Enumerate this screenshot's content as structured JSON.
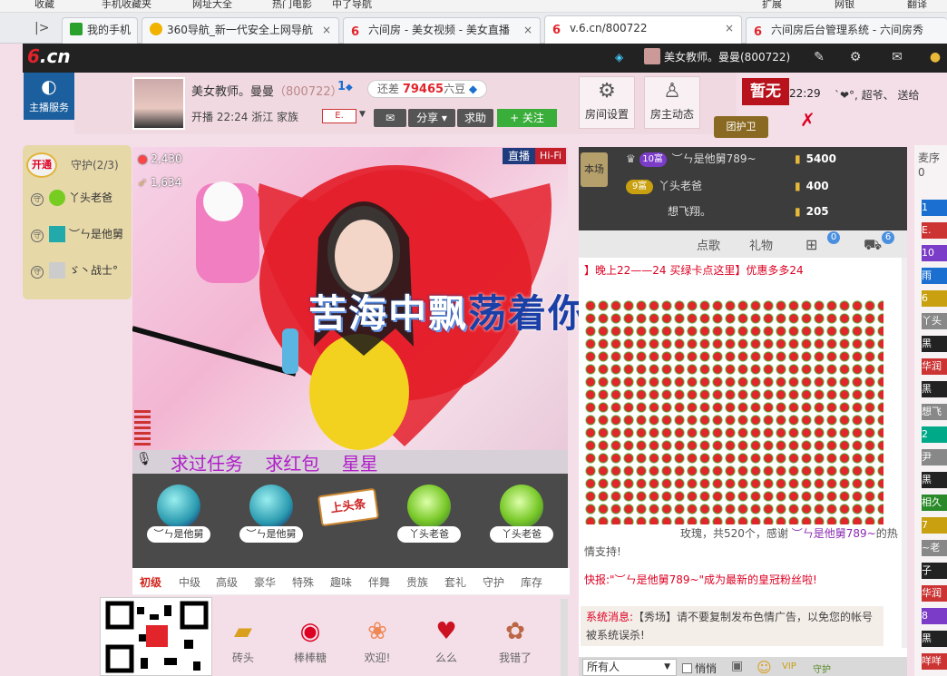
{
  "bookmarks": [
    "收藏",
    "手机收藏夹",
    "网址大全",
    "热门电影",
    "中了导航",
    "扩展",
    "网银",
    "翻译"
  ],
  "tabs": [
    {
      "label": "我的手机",
      "icon": "phone-icon",
      "color": "#2aa12a"
    },
    {
      "label": "360导航_新一代安全上网导航",
      "icon": "plus-icon",
      "color": "#f2b200"
    },
    {
      "label": "六间房 - 美女视频 - 美女直播",
      "icon": "six-icon",
      "color": "#e2242b"
    },
    {
      "label": "v.6.cn/800722",
      "icon": "six-icon",
      "color": "#e2242b",
      "active": true
    },
    {
      "label": "六间房后台管理系统 - 六间房秀",
      "icon": "six-icon",
      "color": "#e2242b"
    }
  ],
  "header": {
    "logo_a": "6",
    "logo_b": ".cn",
    "user": "美女教师。曼曼(800722)"
  },
  "qq": {
    "label": "主播服务"
  },
  "anchor": {
    "name": "美女教师。曼曼",
    "room_id": "（800722）",
    "level": "1",
    "diff_label": "还差",
    "diff_value": "79465",
    "diff_unit": "六豆",
    "meta": "开播 22:24  浙江  家族",
    "family": "E.",
    "share": "分享",
    "help": "求助",
    "follow": "+ 关注"
  },
  "room_buttons": [
    {
      "label": "房间设置",
      "icon": "gear-icon"
    },
    {
      "label": "房主动态",
      "icon": "person-icon"
    }
  ],
  "zanwu": "暂无",
  "guard_team": "团护卫",
  "clock": "22:29",
  "ticker": "`❤°, 超爷、 送给",
  "guard": {
    "open": "开通",
    "title": "守护(2/3)",
    "members": [
      {
        "name": "丫头老爸",
        "thumb": "#7c2"
      },
      {
        "name": "︶ㄣ是他舅",
        "thumb": "#2aa"
      },
      {
        "name": "ゞ丶战士°",
        "thumb": "#ccc"
      }
    ]
  },
  "video": {
    "wealth": "2,430",
    "fans": "1,634",
    "live": "直播",
    "hifi": "Hi-Fi",
    "song_a": "苦海中飘",
    "song_b": "荡着你"
  },
  "task": {
    "text": "求过任务 求红包 星星"
  },
  "seats": [
    {
      "name": "︶ㄣ是他舅",
      "color": "#2a9ab0"
    },
    {
      "name": "︶ㄣ是他舅",
      "color": "#2a9ab0"
    },
    {
      "name": "丫头老爸",
      "color": "#78c828"
    },
    {
      "name": "丫头老爸",
      "color": "#78c828"
    }
  ],
  "headline": "上头条",
  "gift_tabs": [
    "初级",
    "中级",
    "高级",
    "豪华",
    "特殊",
    "趣味",
    "伴舞",
    "贵族",
    "套礼",
    "守护",
    "库存"
  ],
  "gifts": [
    {
      "name": "砖头",
      "icon": "brick-icon"
    },
    {
      "name": "棒棒糖",
      "icon": "lollipop-icon"
    },
    {
      "name": "欢迎!",
      "icon": "welcome-icon"
    },
    {
      "name": "么么",
      "icon": "kiss-icon"
    },
    {
      "name": "我错了",
      "icon": "sorry-icon"
    }
  ],
  "fans": {
    "title": "本场",
    "rows": [
      {
        "rank": "10富",
        "name": "︶ㄣ是他舅789~",
        "score": "5400"
      },
      {
        "rank": "9富",
        "name": "丫头老爸",
        "score": "400"
      },
      {
        "rank": "",
        "name": "想飞翔。",
        "score": "205"
      }
    ]
  },
  "chat_tabs": [
    {
      "label": "点歌"
    },
    {
      "label": "礼物"
    },
    {
      "label": "",
      "icon": "gamepad-icon",
      "badge": "0"
    },
    {
      "label": "",
      "icon": "car-icon",
      "badge": "6"
    }
  ],
  "chat": {
    "promo": "】晚上22——24 买绿卡点这里】优惠多多24",
    "rose_pre": "玫瑰，共520个，感谢",
    "rose_user": "︶ㄣ是他舅789~",
    "rose_post": "的热情支持!",
    "flash": "快报:\"︶ㄣ是他舅789~\"成为最新的皇冠粉丝啦!",
    "sys_label": "系统消息:",
    "sys_text": "【秀场】请不要复制发布色情广告，以免您的帐号被系统误杀!"
  },
  "input": {
    "target": "所有人",
    "whisper": "悄悄"
  },
  "users": {
    "title": "麦序",
    "count": "0",
    "rows": [
      {
        "label": "1",
        "color": "#1a6fd0"
      },
      {
        "label": "E.",
        "color": "#c33"
      },
      {
        "label": "10",
        "color": "#7b3cc8"
      },
      {
        "label": "雨",
        "color": "#1a6fd0"
      },
      {
        "label": "6",
        "color": "#c8a010"
      },
      {
        "label": "丫头",
        "color": "#888"
      },
      {
        "label": "黑",
        "color": "#222"
      },
      {
        "label": "华润",
        "color": "#c33"
      },
      {
        "label": "黑",
        "color": "#222"
      },
      {
        "label": "想飞",
        "color": "#888"
      },
      {
        "label": "2",
        "color": "#0a8"
      },
      {
        "label": "尹",
        "color": "#888"
      },
      {
        "label": "黑",
        "color": "#222"
      },
      {
        "label": "相久",
        "color": "#2a8a2a"
      },
      {
        "label": "7",
        "color": "#c8a010"
      },
      {
        "label": "~老",
        "color": "#888"
      },
      {
        "label": "子",
        "color": "#222"
      },
      {
        "label": "华润",
        "color": "#c33"
      },
      {
        "label": "8",
        "color": "#7b3cc8"
      },
      {
        "label": "黑",
        "color": "#222"
      },
      {
        "label": "咩咩",
        "color": "#c33"
      }
    ]
  }
}
